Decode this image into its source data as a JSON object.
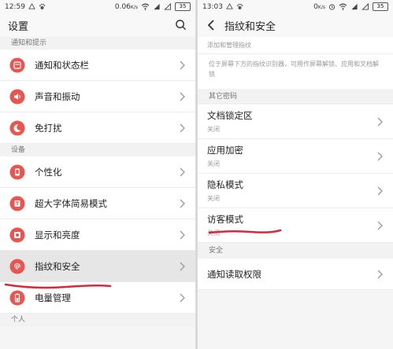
{
  "left": {
    "status": {
      "time": "12:59",
      "speed": "0.06",
      "speed_unit": "K/s",
      "battery": "35"
    },
    "title": "设置",
    "sections": [
      {
        "header": "通知和提示",
        "items": [
          {
            "label": "通知和状态栏",
            "icon": "notification-icon"
          },
          {
            "label": "声音和振动",
            "icon": "sound-icon"
          },
          {
            "label": "免打扰",
            "icon": "moon-icon"
          }
        ]
      },
      {
        "header": "设备",
        "items": [
          {
            "label": "个性化",
            "icon": "personalize-icon"
          },
          {
            "label": "超大字体简易模式",
            "icon": "font-icon"
          },
          {
            "label": "显示和亮度",
            "icon": "brightness-icon"
          },
          {
            "label": "指纹和安全",
            "icon": "fingerprint-icon",
            "selected": true
          },
          {
            "label": "电量管理",
            "icon": "battery-icon"
          }
        ]
      },
      {
        "header": "个人",
        "items": []
      }
    ]
  },
  "right": {
    "status": {
      "time": "13:03",
      "speed": "0",
      "speed_unit": "K/s",
      "battery": "35"
    },
    "title": "指纹和安全",
    "top_item": "添加和管理指纹",
    "note": "位于屏幕下方的指纹识别器，可用作屏幕解锁、应用和文档解锁",
    "sections": [
      {
        "header": "其它密码",
        "items": [
          {
            "label": "文档锁定区",
            "sub": "关闭"
          },
          {
            "label": "应用加密",
            "sub": "关闭"
          },
          {
            "label": "隐私模式",
            "sub": "关闭"
          },
          {
            "label": "访客模式",
            "sub": "关闭"
          }
        ]
      },
      {
        "header": "安全",
        "items": [
          {
            "label": "通知读取权限",
            "sub": ""
          }
        ]
      }
    ]
  },
  "colors": {
    "accent": "#e8564f",
    "annotation": "#d8283a"
  }
}
